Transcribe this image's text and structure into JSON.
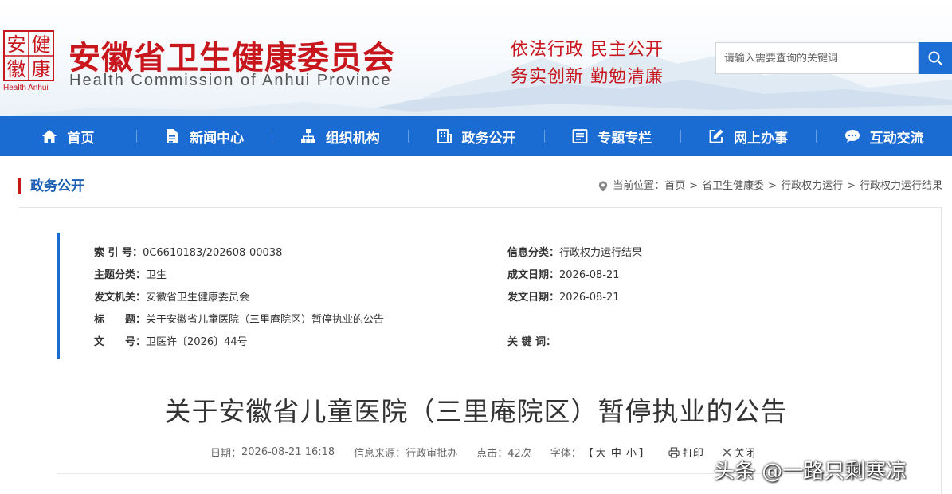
{
  "header": {
    "logo_text": [
      "安",
      "健",
      "徽",
      "康"
    ],
    "logo_en": "Health Anhui",
    "title": "安徽省卫生健康委员会",
    "subtitle": "Health Commission of Anhui Province",
    "motto_line1": "依法行政  民主公开",
    "motto_line2": "务实创新  勤勉清廉",
    "search_placeholder": "请输入需要查询的关键词",
    "search_icon": "search-icon",
    "brand_red": "#c8161d",
    "brand_blue": "#1a6bd2"
  },
  "nav": {
    "items": [
      {
        "label": "首页",
        "icon": "home-icon"
      },
      {
        "label": "新闻中心",
        "icon": "document-icon"
      },
      {
        "label": "组织机构",
        "icon": "org-chart-icon"
      },
      {
        "label": "政务公开",
        "icon": "building-icon"
      },
      {
        "label": "专题专栏",
        "icon": "list-icon"
      },
      {
        "label": "网上办事",
        "icon": "edit-icon"
      },
      {
        "label": "互动交流",
        "icon": "chat-icon"
      }
    ]
  },
  "section": {
    "title": "政务公开",
    "location_icon": "location-pin-icon",
    "breadcrumb_prefix": "当前位置：",
    "breadcrumb": [
      "首页",
      "省卫生健康委",
      "行政权力运行",
      "行政权力运行结果"
    ]
  },
  "meta": {
    "index_label": "索 引 号：",
    "index_value": "0C6610183/202608-00038",
    "category_label": "信息分类：",
    "category_value": "行政权力运行结果",
    "topic_label": "主题分类：",
    "topic_value": "卫生",
    "created_label": "成文日期：",
    "created_value": "2026-08-21",
    "issuer_label": "发文机关：",
    "issuer_value": "安徽省卫生健康委员会",
    "published_label": "发文日期：",
    "published_value": "2026-08-21",
    "title_label": "标　　题：",
    "title_value": "关于安徽省儿童医院（三里庵院区）暂停执业的公告",
    "docno_label": "文　　号：",
    "docno_value": "卫医许〔2026〕44号",
    "keywords_label": "关 键 词：",
    "keywords_value": ""
  },
  "article": {
    "title": "关于安徽省儿童医院（三里庵院区）暂停执业的公告",
    "date_label": "日期：",
    "date_value": "2026-08-21 16:18",
    "source_label": "信息来源：",
    "source_value": "行政审批办",
    "clicks_label": "点击：",
    "clicks_value": "42次",
    "font_label": "字体：",
    "font_open": "【",
    "font_large": "大",
    "font_medium": "中",
    "font_small": "小",
    "font_close": "】",
    "print_label": "打印",
    "print_icon": "printer-icon",
    "close_label": "关闭",
    "close_icon": "close-icon"
  },
  "watermark": "头条 @一路只剩寒凉"
}
